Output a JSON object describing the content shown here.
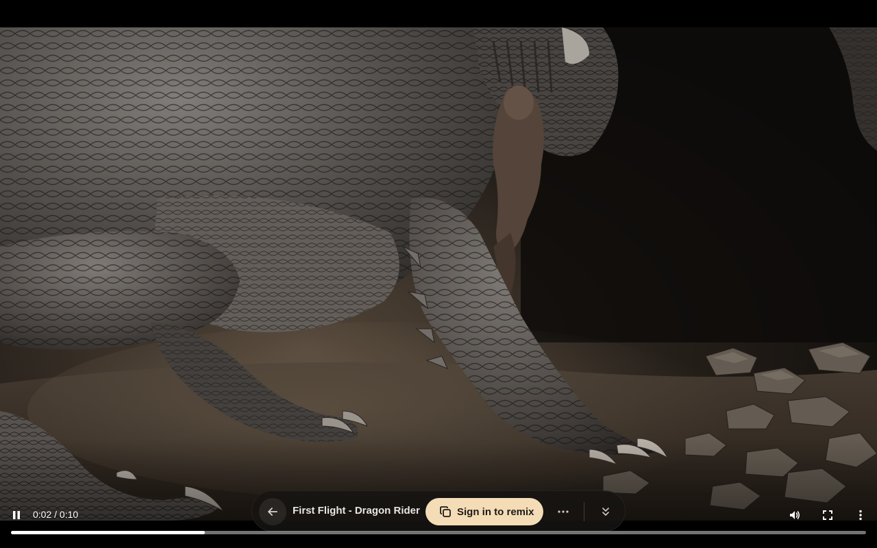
{
  "player": {
    "current_time": "0:02",
    "duration": "0:10",
    "time_display": "0:02 / 0:10",
    "progress": 0.227,
    "state": "playing"
  },
  "toolbar": {
    "title": "First Flight - Dragon Rider",
    "remix_label": "Sign in to remix"
  },
  "icons": {
    "play_state": "pause-icon",
    "back": "arrow-left-icon",
    "remix": "copy-icon",
    "more": "more-horizontal-icon",
    "collapse": "chevrons-down-icon",
    "volume": "volume-icon",
    "fullscreen": "fullscreen-icon",
    "menu": "more-vertical-icon"
  },
  "colors": {
    "remix_button": "#f4dcb6",
    "pill_bg": "#161412",
    "progress_fill": "#ffffff"
  }
}
